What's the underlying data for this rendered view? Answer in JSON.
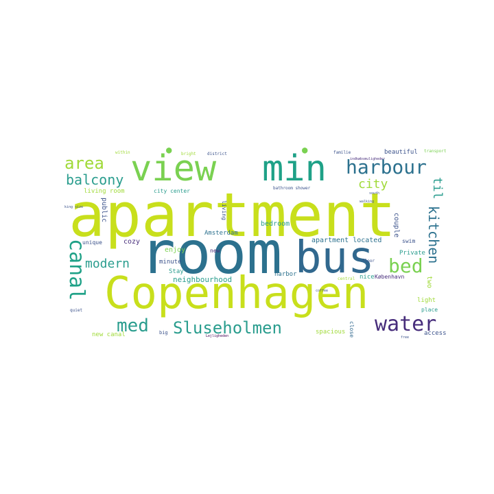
{
  "palette": {
    "lime": "#c8df1c",
    "green": "#7ad151",
    "lightgreen": "#a0da39",
    "teal": "#1fa187",
    "seagreen": "#2a9d8e",
    "blue": "#2c718e",
    "steel": "#31688e",
    "navy": "#3b528b",
    "purple": "#472d7b",
    "darkpurple": "#440154"
  },
  "words": {
    "apartment": "apartment",
    "room": "room",
    "bus": "bus",
    "copenhagen": "Copenhagen",
    "view": "view",
    "min": "min",
    "harbour": "harbour",
    "canal": "canal",
    "water": "water",
    "sluseholmen": "Sluseholmen",
    "med": "med",
    "bed": "bed",
    "kitchen": "kitchen",
    "area": "area",
    "balcony": "balcony",
    "city": "city",
    "til": "til",
    "modern": "modern",
    "neighbourhood": "neighbourhood",
    "apartment_located": "apartment located",
    "bedroom": "bedroom",
    "amsterdam": "Amsterdam",
    "enjoy": "enjoy",
    "cozy": "cozy",
    "minute": "minute",
    "stay": "Stay",
    "unique": "unique",
    "living_room": "living room",
    "city_center": "city center",
    "beautiful": "beautiful",
    "private": "Private",
    "harbor": "harbor",
    "nice": "nice",
    "kobenhavn": "København",
    "light": "light",
    "place": "place",
    "spacious": "spacious",
    "access": "access",
    "new_canal": "new canal",
    "couple": "couple",
    "swim": "swim",
    "two": "two",
    "public": "public",
    "quiet": "quiet",
    "big": "big",
    "close": "close",
    "living": "living",
    "new": "new",
    "within": "within",
    "bright": "bright",
    "district": "district",
    "familie": "familie",
    "indkobsmuligheder": "indkøbsmuligheder",
    "transport": "transport",
    "bathroom_shower": "bathroom shower",
    "floor": "floor",
    "central": "central",
    "lejlighedden": "Lejligheden",
    "coffee": "coffee",
    "king_size": "king size",
    "walking": "walking",
    "south": "south",
    "free": "free"
  }
}
